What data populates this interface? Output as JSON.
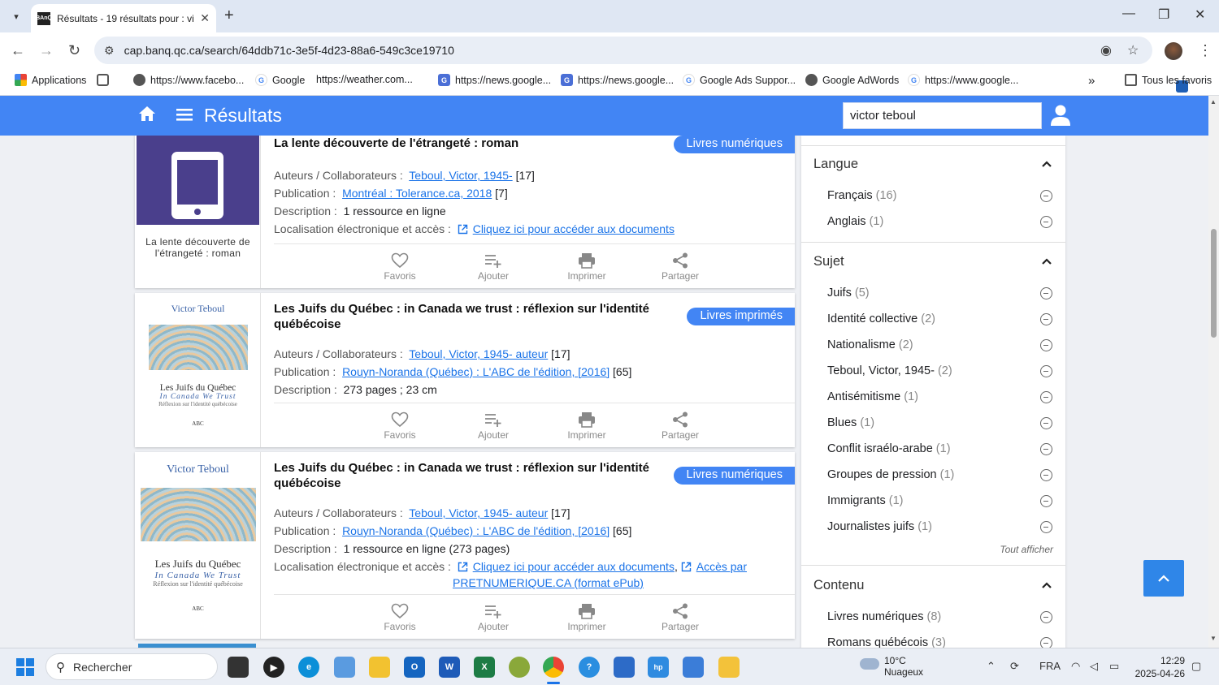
{
  "browser": {
    "tab_title": "Résultats - 19 résultats pour : vi",
    "url": "cap.banq.qc.ca/search/64ddb71c-3e5f-4d23-88a6-549c3ce19710",
    "bookmarks": [
      {
        "label": "Applications",
        "icon": "apps-grid-icon"
      },
      {
        "label": "",
        "icon": "grid-icon"
      },
      {
        "label": "https://www.facebo...",
        "icon": "globe-icon"
      },
      {
        "label": "Google",
        "icon": "google-icon"
      },
      {
        "label": "https://weather.com...",
        "icon": "weather-icon"
      },
      {
        "label": "https://news.google...",
        "icon": "news-icon"
      },
      {
        "label": "https://news.google...",
        "icon": "news-icon"
      },
      {
        "label": "Google Ads Suppor...",
        "icon": "google-icon"
      },
      {
        "label": "Google AdWords",
        "icon": "globe-icon"
      },
      {
        "label": "https://www.google...",
        "icon": "google-icon"
      }
    ],
    "all_bookmarks": "Tous les favoris"
  },
  "header": {
    "title": "Résultats",
    "search_value": "victor teboul",
    "color": "#4285f4"
  },
  "results": [
    {
      "title": "La lente découverte de l'étrangeté : roman",
      "badge": "Livres numériques",
      "thumb_caption": "La lente découverte de l'étrangeté : roman",
      "authors_label": "Auteurs / Collaborateurs :",
      "authors_link": "Teboul, Victor, 1945-",
      "authors_count": "[17]",
      "pub_label": "Publication :",
      "pub_link": "Montréal : Tolerance.ca, 2018",
      "pub_count": "[7]",
      "desc_label": "Description :",
      "desc": "1 ressource en ligne",
      "loc_label": "Localisation électronique et accès :",
      "loc_link": "Cliquez ici pour accéder aux documents"
    },
    {
      "title": "Les Juifs du Québec : in Canada we trust : réflexion sur l'identité québécoise",
      "badge": "Livres imprimés",
      "authors_label": "Auteurs / Collaborateurs :",
      "authors_link": "Teboul, Victor, 1945- auteur",
      "authors_count": "[17]",
      "pub_label": "Publication :",
      "pub_link": "Rouyn-Noranda (Québec) : L'ABC de l'édition, [2016]",
      "pub_count": "[65]",
      "desc_label": "Description :",
      "desc": "273 pages ; 23 cm",
      "cover": {
        "author": "Victor Teboul",
        "title": "Les Juifs du Québec",
        "subtitle": "In Canada We Trust",
        "tagline": "Réflexion sur l'identité québécoise",
        "publisher": "ABC"
      }
    },
    {
      "title": "Les Juifs du Québec : in Canada we trust : réflexion sur l'identité québécoise",
      "badge": "Livres numériques",
      "authors_label": "Auteurs / Collaborateurs :",
      "authors_link": "Teboul, Victor, 1945- auteur",
      "authors_count": "[17]",
      "pub_label": "Publication :",
      "pub_link": "Rouyn-Noranda (Québec) : L'ABC de l'édition, [2016]",
      "pub_count": "[65]",
      "desc_label": "Description :",
      "desc": "1 ressource en ligne (273 pages)",
      "loc_label": "Localisation électronique et accès :",
      "loc_link": "Cliquez ici pour accéder aux documents",
      "loc_sep": ",",
      "loc_link2a": "Accès par",
      "loc_link2b": "PRETNUMERIQUE.CA (format ePub)",
      "cover": {
        "author": "Victor Teboul",
        "title": "Les Juifs du Québec",
        "subtitle": "In Canada We Trust",
        "tagline": "Réflexion sur l'identité québécoise",
        "publisher": "ABC"
      }
    }
  ],
  "actions": {
    "favorite": "Favoris",
    "add": "Ajouter",
    "print": "Imprimer",
    "share": "Partager"
  },
  "facets": {
    "langue": {
      "title": "Langue",
      "items": [
        {
          "label": "Français",
          "count": "(16)"
        },
        {
          "label": "Anglais",
          "count": "(1)"
        }
      ]
    },
    "sujet": {
      "title": "Sujet",
      "items": [
        {
          "label": "Juifs",
          "count": "(5)"
        },
        {
          "label": "Identité collective",
          "count": "(2)"
        },
        {
          "label": "Nationalisme",
          "count": "(2)"
        },
        {
          "label": "Teboul, Victor, 1945-",
          "count": "(2)"
        },
        {
          "label": "Antisémitisme",
          "count": "(1)"
        },
        {
          "label": "Blues",
          "count": "(1)"
        },
        {
          "label": "Conflit israélo-arabe",
          "count": "(1)"
        },
        {
          "label": "Groupes de pression",
          "count": "(1)"
        },
        {
          "label": "Immigrants",
          "count": "(1)"
        },
        {
          "label": "Journalistes juifs",
          "count": "(1)"
        }
      ],
      "show_all": "Tout afficher"
    },
    "contenu": {
      "title": "Contenu",
      "items": [
        {
          "label": "Livres numériques",
          "count": "(8)"
        },
        {
          "label": "Romans québécois",
          "count": "(3)"
        }
      ]
    }
  },
  "taskbar": {
    "search_placeholder": "Rechercher",
    "weather_temp": "10°C",
    "weather_desc": "Nuageux",
    "lang": "FRA",
    "time": "12:29",
    "date": "2025-04-26"
  }
}
